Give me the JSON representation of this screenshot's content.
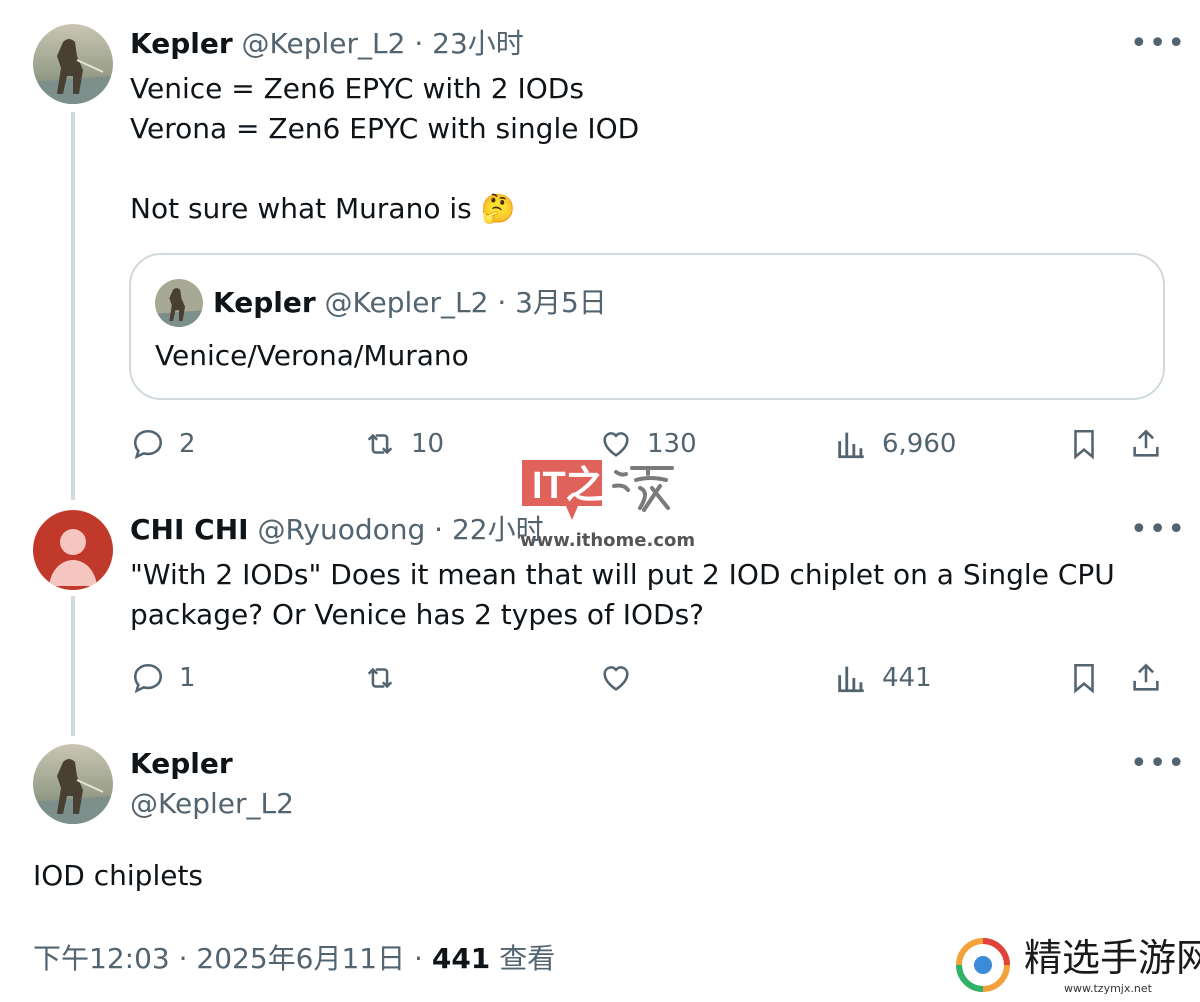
{
  "tweets": [
    {
      "name": "Kepler",
      "handle": "@Kepler_L2",
      "time": "23小时",
      "text_lines": [
        "Venice = Zen6 EPYC with 2 IODs",
        "Verona = Zen6 EPYC with single IOD"
      ],
      "text_last": "Not sure what Murano is",
      "emoji": "🤔",
      "quote": {
        "name": "Kepler",
        "handle": "@Kepler_L2",
        "time": "3月5日",
        "text": "Venice/Verona/Murano"
      },
      "stats": {
        "replies": "2",
        "reposts": "10",
        "likes": "130",
        "views": "6,960"
      }
    },
    {
      "name": "CHI CHI",
      "handle": "@Ryuodong",
      "time": "22小时",
      "text_lines": [
        "\"With 2 IODs\" Does it mean that will put 2 IOD chiplet on a Single CPU",
        "package? Or Venice has 2 types of IODs?"
      ],
      "stats": {
        "replies": "1",
        "reposts": "",
        "likes": "",
        "views": "441"
      }
    }
  ],
  "main_tweet": {
    "name": "Kepler",
    "handle": "@Kepler_L2",
    "text": "IOD chiplets",
    "time": "下午12:03",
    "date": "2025年6月11日",
    "views": "441",
    "views_label": "查看"
  },
  "separator": "·",
  "more_label": "•••",
  "watermarks": {
    "ithome_logo": "IT之家",
    "ithome_url": "www.ithome.com",
    "site_name": "精选手游网",
    "site_url": "www.tzymjx.net"
  },
  "colors": {
    "text": "#0f1419",
    "muted": "#536471",
    "border": "#cfd9de",
    "chichi_avatar": "#c1392b",
    "ithome_red": "#d9463e"
  },
  "icons": [
    "reply-icon",
    "repost-icon",
    "like-icon",
    "views-icon",
    "bookmark-icon",
    "share-icon",
    "more-icon"
  ]
}
